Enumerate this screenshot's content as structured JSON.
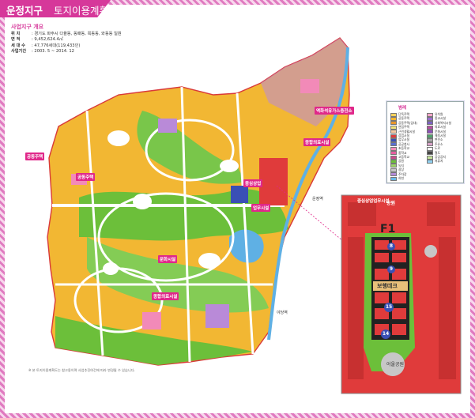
{
  "title": {
    "main": "운정지구",
    "sub": "토지이용계획도"
  },
  "overview": {
    "heading": "사업지구 개요",
    "rows": [
      {
        "key": "위      치",
        "value": "경기도 파주시 다율동, 동패동, 목동동, 와동동 일원"
      },
      {
        "key": "면      적",
        "value": "9,452,624.4㎡"
      },
      {
        "key": "세 대 수",
        "value": "47,776세대(119,433인)"
      },
      {
        "key": "사업기간",
        "value": "2003. 5 ~ 2014. 12"
      }
    ]
  },
  "map_labels": [
    "공동주택",
    "공동주택",
    "중심상업",
    "업무시설",
    "문화시설",
    "종합의료시설",
    "종합의료시설",
    "액화석유가스충전소",
    "운정역",
    "야당역"
  ],
  "inset": {
    "header": "중심상업업무시설",
    "park_top": "공원",
    "park_bottom": "어울공원",
    "block_code": "F1",
    "deck": "보행데크",
    "numbers": [
      "8",
      "9",
      "15",
      "14"
    ]
  },
  "legend": {
    "title": "범례",
    "left_items": [
      {
        "label": "단독주택",
        "color": "#f5d25c"
      },
      {
        "label": "공동주택",
        "color": "#f4b62e"
      },
      {
        "label": "공동주택(임대)",
        "color": "#e8962a"
      },
      {
        "label": "연립주택",
        "color": "#f1e27a"
      },
      {
        "label": "근린생활시설",
        "color": "#f7c9a0"
      },
      {
        "label": "상업시설",
        "color": "#e03b3b"
      },
      {
        "label": "업무시설",
        "color": "#3a4fb5"
      },
      {
        "label": "공공청사",
        "color": "#5a6fd0"
      },
      {
        "label": "초등학교",
        "color": "#f28ab8"
      },
      {
        "label": "중학교",
        "color": "#e85ca0"
      },
      {
        "label": "고등학교",
        "color": "#c94c8c"
      },
      {
        "label": "공원",
        "color": "#6cbf3a"
      },
      {
        "label": "녹지",
        "color": "#9ed36a"
      },
      {
        "label": "광장",
        "color": "#c7c7c7"
      },
      {
        "label": "주차장",
        "color": "#b58ad8"
      },
      {
        "label": "하천",
        "color": "#69b7e8"
      }
    ],
    "right_items": [
      {
        "label": "유치원",
        "color": "#f7a6c8"
      },
      {
        "label": "종교시설",
        "color": "#9b6fcf"
      },
      {
        "label": "사회복지시설",
        "color": "#7d61c2"
      },
      {
        "label": "의료시설",
        "color": "#b64fa3"
      },
      {
        "label": "문화시설",
        "color": "#8d4fb8"
      },
      {
        "label": "체육시설",
        "color": "#4ea26a"
      },
      {
        "label": "변전소",
        "color": "#a9a9a9"
      },
      {
        "label": "주유소",
        "color": "#d9a3c9"
      },
      {
        "label": "도로",
        "color": "#ffffff"
      },
      {
        "label": "철도",
        "color": "#444444"
      },
      {
        "label": "공공공지",
        "color": "#c4e39a"
      },
      {
        "label": "저류지",
        "color": "#8fd0f0"
      }
    ]
  },
  "footnote": "※ 본 토지이용계획도는 참고용이며 사업추진여건에 따라 변경될 수 있습니다.",
  "colors": {
    "accent": "#d6389a",
    "residential": "#f4b62e",
    "park": "#6cbf3a",
    "commercial": "#e03b3b",
    "road": "#ffffff",
    "water": "#69b7e8"
  }
}
